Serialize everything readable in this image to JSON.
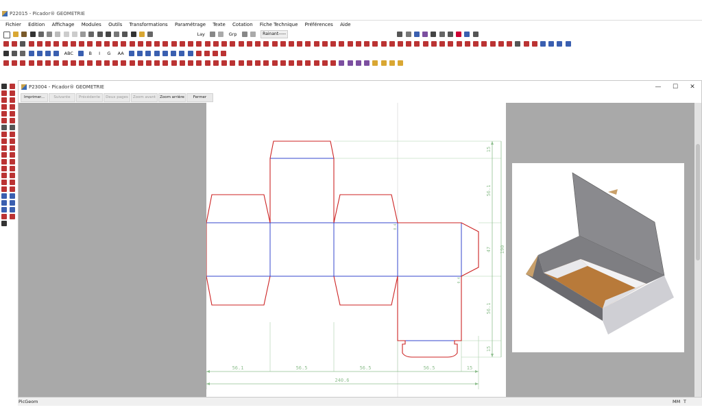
{
  "app": {
    "title": "P22015 - Picador® GEOMETRIE"
  },
  "menu": [
    "Fichier",
    "Edition",
    "Affichage",
    "Modules",
    "Outils",
    "Transformations",
    "Paramétrage",
    "Texte",
    "Cotation",
    "Fiche Technique",
    "Préférences",
    "Aide"
  ],
  "toolbar": {
    "layer_label": "Lay",
    "group_label": "Grp",
    "crease_label": "Rainant-----",
    "text_abc": "ABC",
    "text_b": "B",
    "text_i": "I",
    "text_g": "G",
    "text_aa": "AA"
  },
  "doc": {
    "title": "P23004 - Picador® GEOMETRIE",
    "buttons": {
      "print": "Imprimer...",
      "next": "Suivante",
      "prev": "Précédente",
      "two_pages": "Deux pages",
      "zoom_in": "Zoom avant",
      "zoom_out": "Zoom arrière",
      "close": "Fermer"
    }
  },
  "drawing": {
    "dims_bottom": [
      "56.1",
      "56.5",
      "56.5",
      "56.5",
      "15"
    ],
    "total_width": "240.6",
    "dims_right": [
      "15",
      "56.1",
      "47",
      "56.1",
      "15"
    ],
    "total_height": "190",
    "small_labels": [
      "0.4",
      "0.4"
    ]
  },
  "status": {
    "left": "PicGeom",
    "unit": "MM",
    "flag": "T"
  },
  "colors": {
    "cut": "#cc2222",
    "crease": "#3344cc",
    "dim": "#8fbf8f",
    "canvas": "#a9a9a9"
  }
}
